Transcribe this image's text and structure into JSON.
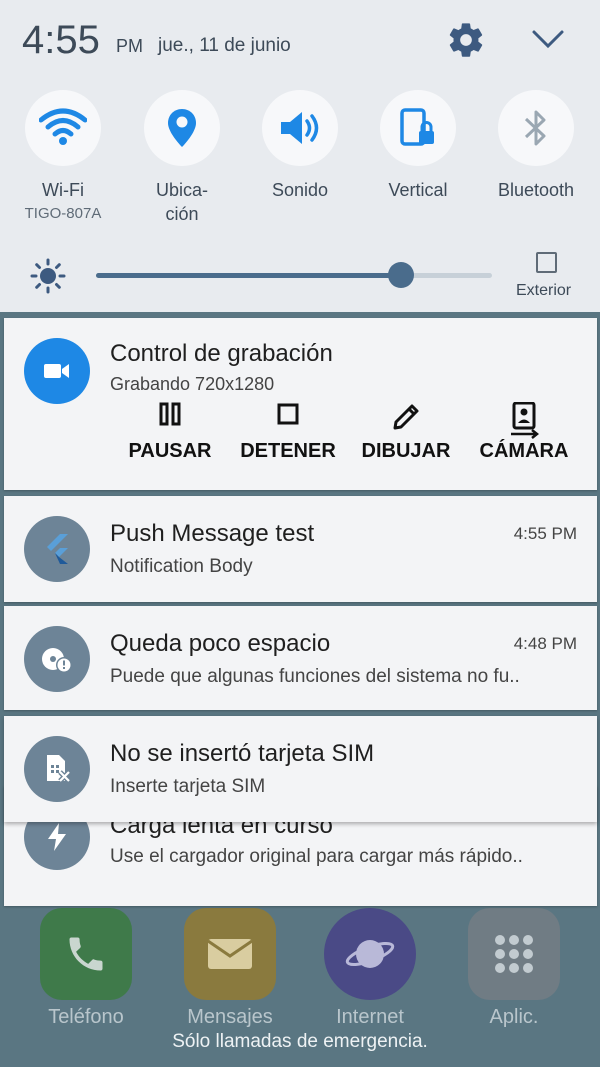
{
  "status": {
    "time": "4:55",
    "ampm": "PM",
    "date": "jue., 11 de junio"
  },
  "toggles": [
    {
      "icon": "wifi-icon",
      "label": "Wi-Fi",
      "sublabel": "TIGO-807A",
      "color": "#1e88e5"
    },
    {
      "icon": "location-icon",
      "label": "Ubica-\nción",
      "color": "#1e88e5"
    },
    {
      "icon": "sound-icon",
      "label": "Sonido",
      "color": "#1e88e5"
    },
    {
      "icon": "rotation-lock-icon",
      "label": "Vertical",
      "color": "#1e88e5"
    },
    {
      "icon": "bluetooth-icon",
      "label": "Bluetooth",
      "color": "#9aa7b2"
    }
  ],
  "toggle_labels": {
    "wifi": "Wi-Fi",
    "wifi_sub": "TIGO-807A",
    "location_line1": "Ubica-",
    "location_line2": "ción",
    "sound": "Sonido",
    "rotation": "Vertical",
    "bluetooth": "Bluetooth"
  },
  "brightness": {
    "level": 0.77,
    "outdoor_label": "Exterior",
    "outdoor_checked": false
  },
  "notifications": {
    "recording": {
      "title": "Control de grabación",
      "body": "Grabando 720x1280",
      "actions": {
        "pause": "PAUSAR",
        "stop": "DETENER",
        "draw": "DIBUJAR",
        "camera": "CÁMARA"
      }
    },
    "push": {
      "title": "Push Message test",
      "body": "Notification Body",
      "time": "4:55 PM"
    },
    "storage": {
      "title": "Queda poco espacio",
      "body": "Puede que algunas funciones del sistema no fu..",
      "time": "4:48 PM"
    },
    "sim": {
      "title": "No se insertó tarjeta SIM",
      "body": "Inserte tarjeta SIM"
    },
    "charging": {
      "title": "Carga lenta en curso",
      "body": "Use el cargador original para cargar más rápido.."
    }
  },
  "home": {
    "apps": {
      "phone": "Teléfono",
      "messages": "Mensajes",
      "internet": "Internet",
      "apps": "Aplic."
    },
    "emergency": "Sólo llamadas de emergencia."
  },
  "colors": {
    "accent": "#1e88e5",
    "slider": "#4a6c8c",
    "panel_bg": "#e8ebef",
    "notification_icon_bg": "#6d8497"
  }
}
